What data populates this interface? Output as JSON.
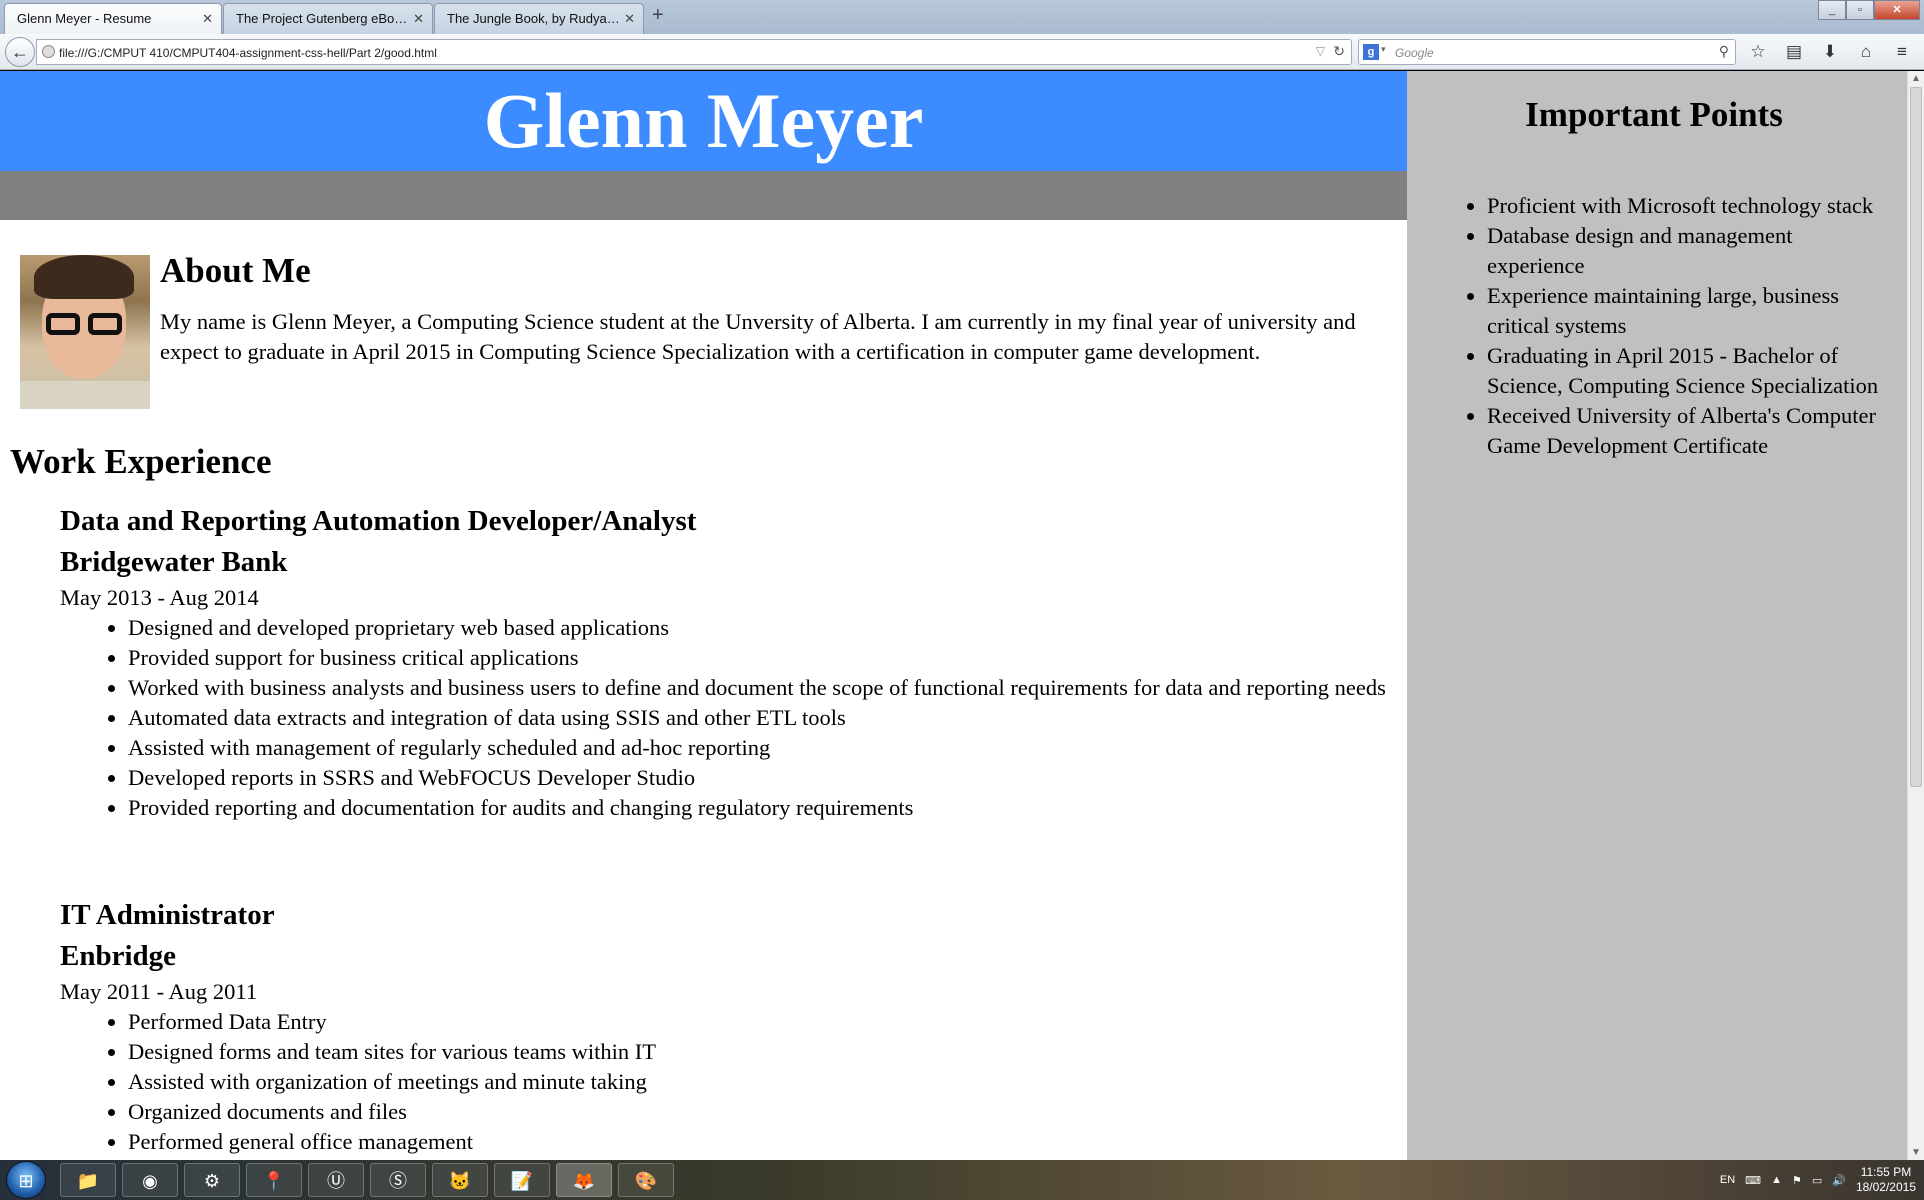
{
  "browser": {
    "tabs": [
      {
        "title": "Glenn Meyer - Resume",
        "active": true
      },
      {
        "title": "The Project Gutenberg eBook o...",
        "active": false
      },
      {
        "title": "The Jungle Book, by Rudyard K...",
        "active": false
      }
    ],
    "new_tab_label": "+",
    "url": "file:///G:/CMPUT 410/CMPUT404-assignment-css-hell/Part 2/good.html",
    "search_placeholder": "Google",
    "search_engine_letter": "g",
    "icons": [
      "back-icon",
      "globe-icon",
      "reload-icon",
      "search-icon",
      "bookmark-star-icon",
      "reading-list-icon",
      "download-icon",
      "home-icon",
      "menu-icon"
    ]
  },
  "page": {
    "name": "Glenn Meyer",
    "about": {
      "heading": "About Me",
      "text": "My name is Glenn Meyer, a Computing Science student at the Unversity of Alberta. I am currently in my final year of university and expect to graduate in April 2015 in Computing Science Specialization with a certification in computer game development."
    },
    "work_heading": "Work Experience",
    "jobs": [
      {
        "role": "Data and Reporting Automation Developer/Analyst",
        "company": "Bridgewater Bank",
        "dates": "May 2013 - Aug 2014",
        "duties": [
          "Designed and developed proprietary web based applications",
          "Provided support for business critical applications",
          "Worked with business analysts and business users to define and document the scope of functional requirements for data and reporting needs",
          "Automated data extracts and integration of data using SSIS and other ETL tools",
          "Assisted with management of regularly scheduled and ad-hoc reporting",
          "Developed reports in SSRS and WebFOCUS Developer Studio",
          "Provided reporting and documentation for audits and changing regulatory requirements"
        ]
      },
      {
        "role": "IT Administrator",
        "company": "Enbridge",
        "dates": "May 2011 - Aug 2011",
        "duties": [
          "Performed Data Entry",
          "Designed forms and team sites for various teams within IT",
          "Assisted with organization of meetings and minute taking",
          "Organized documents and files",
          "Performed general office management"
        ]
      }
    ],
    "sidebar": {
      "heading": "Important Points",
      "points": [
        "Proficient with Microsoft technology stack",
        "Database design and management experience",
        "Experience maintaining large, business critical systems",
        "Graduating in April 2015 - Bachelor of Science, Computing Science Specialization",
        "Received University of Alberta's Computer Game Development Certificate"
      ]
    },
    "colors": {
      "header": "#3c8bff",
      "band": "#808080",
      "sidebar": "#c0c0c0"
    }
  },
  "taskbar": {
    "apps": [
      "windows-explorer-icon",
      "chrome-icon",
      "steam-icon",
      "maps-icon",
      "uplay-icon",
      "skype-icon",
      "github-icon",
      "notepad-icon",
      "firefox-icon",
      "paint-icon"
    ],
    "language": "EN",
    "time": "11:55 PM",
    "date": "18/02/2015"
  }
}
